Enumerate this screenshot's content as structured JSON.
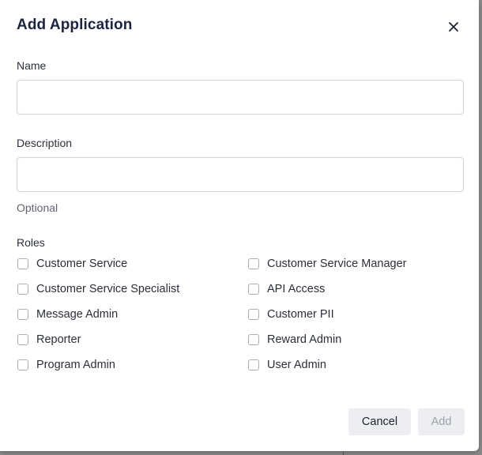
{
  "dialog": {
    "title": "Add Application",
    "close_icon": "close-icon"
  },
  "name_field": {
    "label": "Name",
    "value": "",
    "placeholder": ""
  },
  "description_field": {
    "label": "Description",
    "value": "",
    "placeholder": "",
    "helper": "Optional"
  },
  "roles": {
    "label": "Roles",
    "items": [
      {
        "label": "Customer Service",
        "checked": false
      },
      {
        "label": "Customer Service Manager",
        "checked": false
      },
      {
        "label": "Customer Service Specialist",
        "checked": false
      },
      {
        "label": "API Access",
        "checked": false
      },
      {
        "label": "Message Admin",
        "checked": false
      },
      {
        "label": "Customer PII",
        "checked": false
      },
      {
        "label": "Reporter",
        "checked": false
      },
      {
        "label": "Reward Admin",
        "checked": false
      },
      {
        "label": "Program Admin",
        "checked": false
      },
      {
        "label": "User Admin",
        "checked": false
      }
    ]
  },
  "actions": {
    "cancel_label": "Cancel",
    "add_label": "Add",
    "add_disabled": true
  },
  "colors": {
    "title": "#1c2440",
    "text": "#2b2f3a",
    "helper": "#5f6470",
    "button_bg": "#eceef1",
    "disabled_text": "#9ba0aa"
  }
}
